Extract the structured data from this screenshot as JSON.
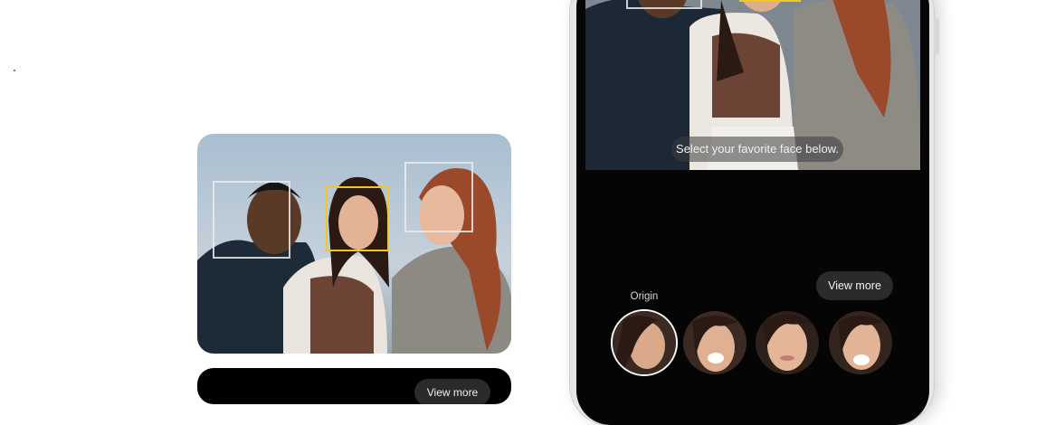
{
  "phone_screen": {
    "hint_text": "Select your favorite face below.",
    "view_more_label": "View more",
    "origin_label": "Origin"
  },
  "card": {
    "view_more_label": "View more"
  },
  "face_options": [
    {
      "name": "face-option-origin",
      "selected": true
    },
    {
      "name": "face-option-2",
      "selected": false
    },
    {
      "name": "face-option-3",
      "selected": false
    },
    {
      "name": "face-option-4",
      "selected": false
    }
  ],
  "colors": {
    "selected_face_box": "#f3c623",
    "face_box": "#ebebeb",
    "screen_bg": "#050505"
  }
}
